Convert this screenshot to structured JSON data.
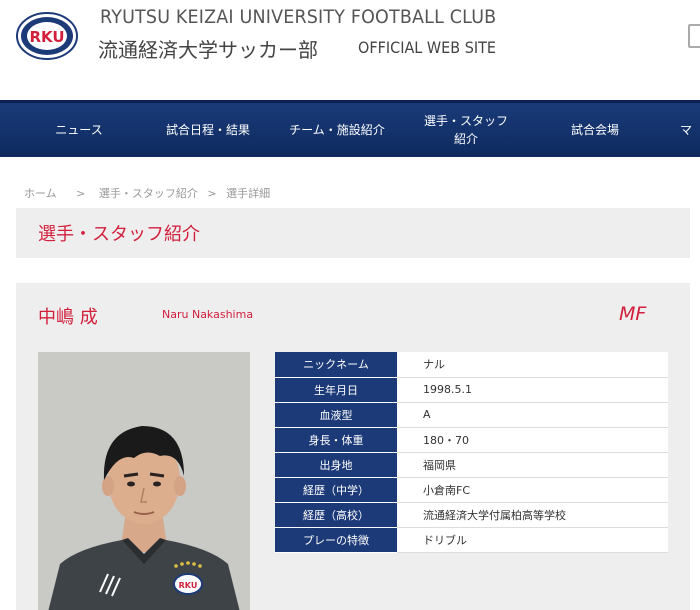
{
  "header": {
    "logo_text": "RKU",
    "title_en": "RYUTSU KEIZAI UNIVERSITY FOOTBALL CLUB",
    "title_ja": "流通経済大学サッカー部",
    "subtitle": "OFFICIAL WEB SITE"
  },
  "nav": {
    "items": [
      {
        "label": "ニュース"
      },
      {
        "label": "試合日程・結果"
      },
      {
        "label": "チーム・施設紹介"
      },
      {
        "label": "選手・スタッフ\n紹介"
      },
      {
        "label": "試合会場"
      },
      {
        "label": "マ"
      }
    ]
  },
  "breadcrumb": {
    "home": "ホーム",
    "sep": ">",
    "section": "選手・スタッフ紹介",
    "sep2": ">",
    "current": "選手詳細"
  },
  "page": {
    "title": "選手・スタッフ紹介"
  },
  "player": {
    "name_ja": "中嶋 成",
    "name_en": "Naru Nakashima",
    "position": "MF",
    "info": [
      {
        "key": "ニックネーム",
        "value": "ナル"
      },
      {
        "key": "生年月日",
        "value": "1998.5.1"
      },
      {
        "key": "血液型",
        "value": "A"
      },
      {
        "key": "身長・体重",
        "value": "180・70"
      },
      {
        "key": "出身地",
        "value": "福岡県"
      },
      {
        "key": "経歴（中学）",
        "value": "小倉南FC"
      },
      {
        "key": "経歴（高校）",
        "value": "流通経済大学付属柏高等学校"
      },
      {
        "key": "プレーの特徴",
        "value": "ドリブル"
      }
    ]
  },
  "colors": {
    "accent": "#d21f3c",
    "nav_bg": "#0e2a5e",
    "label_bg": "#1d3a78",
    "panel_bg": "#eeeeee"
  }
}
